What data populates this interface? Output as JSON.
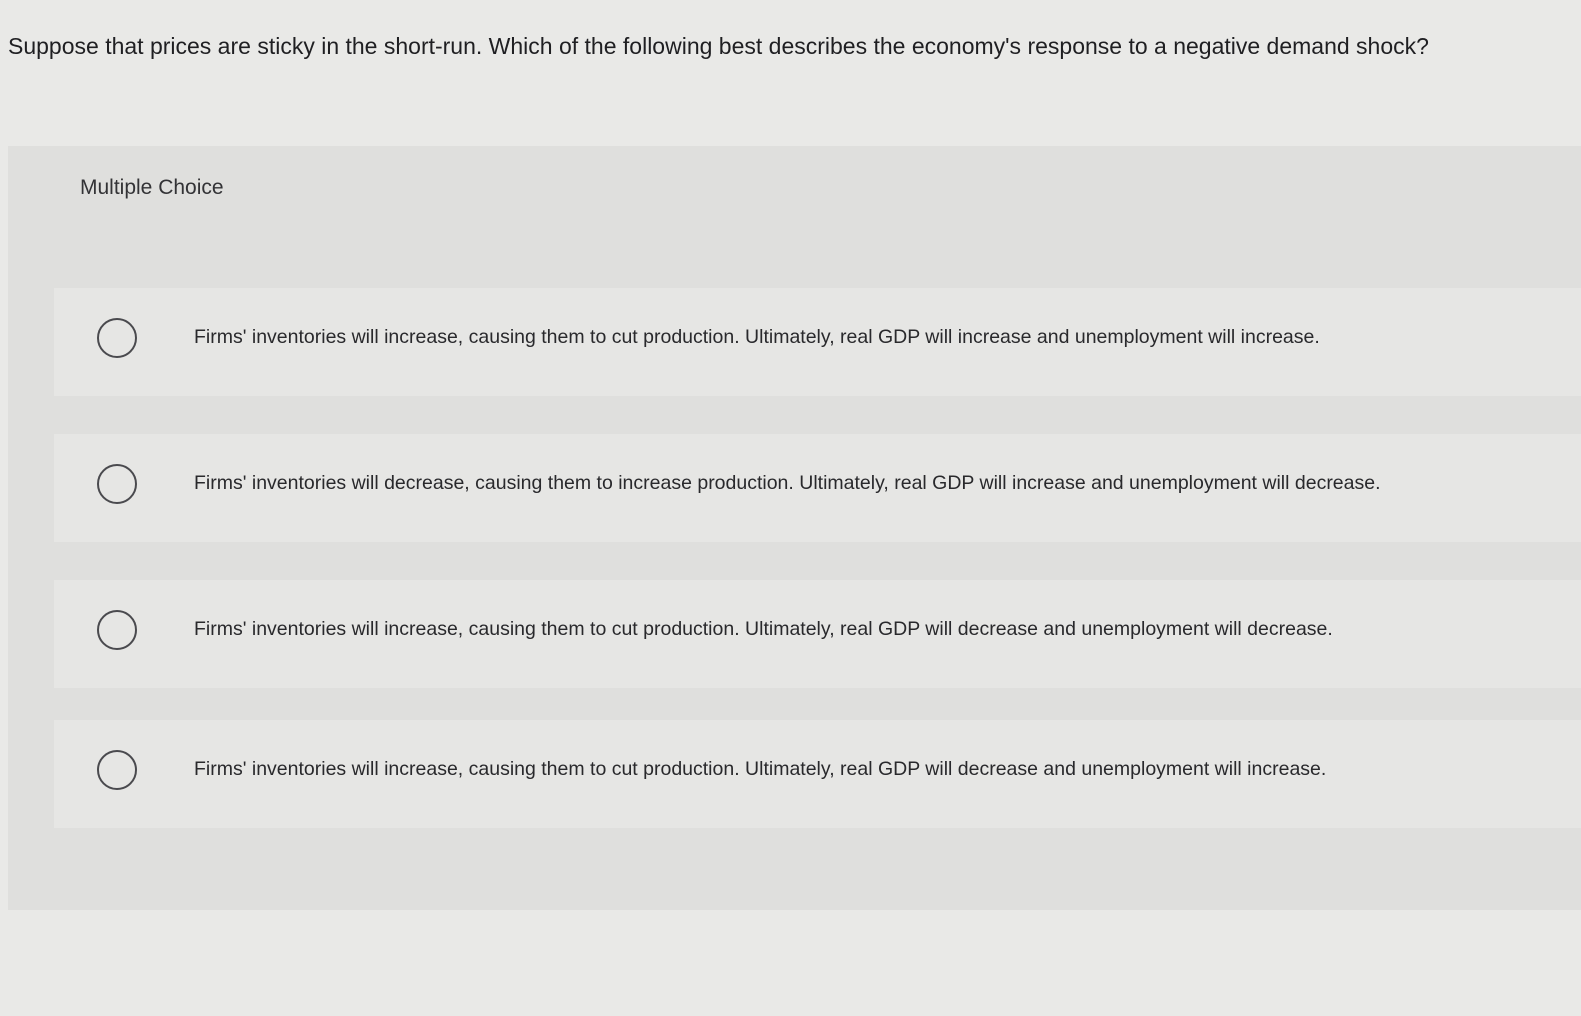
{
  "question": {
    "text": "Suppose that prices are sticky in the short-run. Which of the following best describes the economy's response to a negative demand shock?"
  },
  "panel": {
    "label": "Multiple Choice"
  },
  "options": [
    {
      "text": "Firms' inventories will increase, causing them to cut production. Ultimately, real GDP will increase and unemployment will increase."
    },
    {
      "text": "Firms' inventories will decrease, causing them to increase production. Ultimately, real GDP will increase and unemployment will decrease."
    },
    {
      "text": "Firms' inventories will increase, causing them to cut production. Ultimately, real GDP will decrease and unemployment will decrease."
    },
    {
      "text": "Firms' inventories will increase, causing them to cut production. Ultimately, real GDP will decrease and unemployment will increase."
    }
  ]
}
